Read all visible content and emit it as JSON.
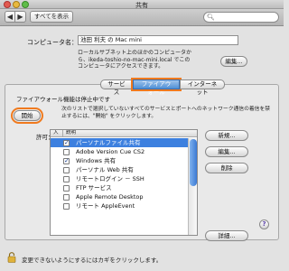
{
  "window": {
    "title": "共有"
  },
  "toolbar": {
    "back_icon": "back-arrow-icon",
    "forward_icon": "forward-arrow-icon",
    "show_all_label": "すべてを表示",
    "search_placeholder": "",
    "search_icon": "magnifier-icon"
  },
  "computer": {
    "name_label": "コンピュータ名：",
    "name_value": "池田 利夫 の Mac mini",
    "description": "ローカルサブネット上のほかのコンピュータから、ikeda-toshio-no-mac-mini.local でこのコンピュータにアクセスできます。",
    "edit_button": "編集..."
  },
  "tabs": [
    {
      "label": "サービス",
      "active": false
    },
    {
      "label": "ファイアウォール",
      "active": true
    },
    {
      "label": "インターネット",
      "active": false
    }
  ],
  "firewall": {
    "status": "ファイアウォール機能は停止中です",
    "start_button": "開始",
    "start_description": "次のリストで選択していないすべてのサービスとポートへのネットワーク通信の着信を禁止するには、\"開始\" をクリックします。",
    "allow_label": "許可：",
    "list_header_on": "入",
    "list_header_desc": "説明",
    "services": [
      {
        "label": "パーソナルファイル共有",
        "checked": true,
        "selected": true
      },
      {
        "label": "Adobe Version Cue CS2",
        "checked": false,
        "selected": false
      },
      {
        "label": "Windows 共有",
        "checked": true,
        "selected": false
      },
      {
        "label": "パーソナル Web 共有",
        "checked": false,
        "selected": false
      },
      {
        "label": "リモートログイン － SSH",
        "checked": false,
        "selected": false
      },
      {
        "label": "FTP サービス",
        "checked": false,
        "selected": false
      },
      {
        "label": "Apple Remote Desktop",
        "checked": false,
        "selected": false
      },
      {
        "label": "リモート AppleEvent",
        "checked": false,
        "selected": false
      }
    ],
    "new_button": "新規...",
    "edit_button": "編集...",
    "delete_button": "削除",
    "details_button": "詳細...",
    "help_label": "?"
  },
  "footer": {
    "lock_icon": "lock-icon",
    "lock_text": "変更できないようにするにはカギをクリックします。"
  }
}
